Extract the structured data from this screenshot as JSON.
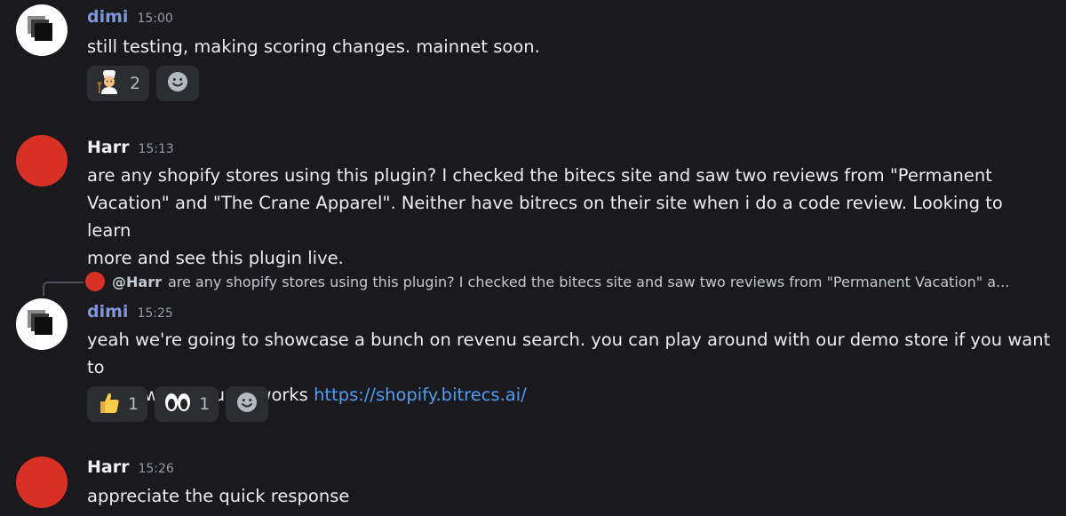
{
  "messages": [
    {
      "author": "dimi",
      "time": "15:00",
      "text": "still testing, making scoring changes. mainnet soon.",
      "reactions": [
        {
          "emoji": "cook",
          "count": "2"
        }
      ]
    },
    {
      "author": "Harr",
      "time": "15:13",
      "lines": [
        "are any shopify stores using this plugin? I checked the bitecs site and saw two reviews from \"Permanent",
        "Vacation\" and \"The Crane Apparel\". Neither have bitrecs on their site when i do a code review. Looking to learn",
        "more and see this plugin live."
      ]
    },
    {
      "author": "dimi",
      "time": "15:25",
      "reply": {
        "user": "@Harr",
        "text": "are any shopify stores using this plugin? I checked the bitecs site and saw two reviews from \"Permanent Vacation\" a..."
      },
      "line1": "yeah we're going to showcase a bunch on revenu search. you can play around with our demo store if you want to",
      "line2": "see how the plugin works",
      "link": "https://shopify.bitrecs.ai/",
      "reactions": [
        {
          "emoji": "thumbs-up",
          "count": "1"
        },
        {
          "emoji": "eyes",
          "count": "1"
        }
      ]
    },
    {
      "author": "Harr",
      "time": "15:26",
      "text": "appreciate the quick response"
    }
  ],
  "colors": {
    "background": "#1a1a1e",
    "dimi_name": "#7f95d6",
    "link": "#4f9cf0",
    "harr_avatar": "#d93025",
    "reaction_bg": "#2b2d31"
  }
}
